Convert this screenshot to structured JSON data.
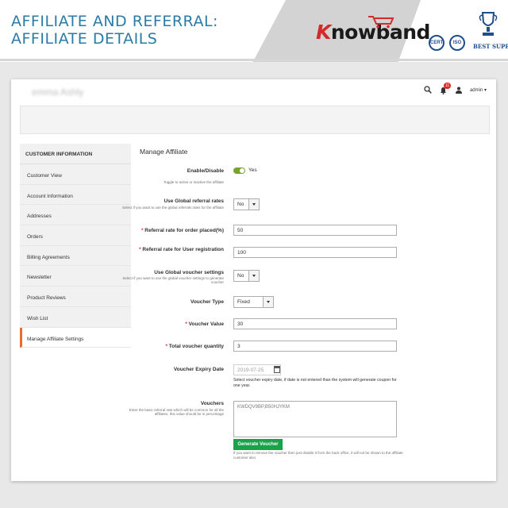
{
  "banner": {
    "title": "AFFILIATE AND REFERRAL: AFFILIATE DETAILS",
    "logo_k": "K",
    "logo_rest": "nowband",
    "badge_iso": "ISO",
    "badge_seal": "CERT",
    "best_support": "BEST SUPPORT"
  },
  "header": {
    "customer_name": "emma Ashly",
    "notification_count": "11",
    "user_name": "admin ▾"
  },
  "sidebar": {
    "header": "CUSTOMER INFORMATION",
    "items": [
      {
        "label": "Customer View"
      },
      {
        "label": "Account Information"
      },
      {
        "label": "Addresses"
      },
      {
        "label": "Orders"
      },
      {
        "label": "Billing Agreements"
      },
      {
        "label": "Newsletter"
      },
      {
        "label": "Product Reviews"
      },
      {
        "label": "Wish List"
      },
      {
        "label": "Manage Affiliate Settings"
      }
    ]
  },
  "form": {
    "title": "Manage Affiliate",
    "enable": {
      "label": "Enable/Disable",
      "value": "Yes",
      "note": "Toggle to active or inactive the affiliate"
    },
    "global_referral": {
      "label": "Use Global referral rates",
      "value": "No",
      "note": "Select if you want to use the global referrals rates for the affiliate"
    },
    "referral_order": {
      "label": "Referral rate for order placed(%)",
      "value": "50"
    },
    "referral_user": {
      "label": "Referral rate for User registration",
      "value": "100"
    },
    "global_voucher": {
      "label": "Use Global voucher settings",
      "value": "No",
      "note": "Select if you want to use the global voucher settings to generate voucher"
    },
    "voucher_type": {
      "label": "Voucher Type",
      "value": "Fixed"
    },
    "voucher_value": {
      "label": "Voucher Value",
      "value": "30"
    },
    "voucher_quantity": {
      "label": "Total voucher quantity",
      "value": "3"
    },
    "expiry": {
      "label": "Voucher Expiry Date",
      "placeholder": "2019-07-25",
      "help": "Select voucher expiry date, if date is not entered than the system will generate coupon for one year."
    },
    "vouchers": {
      "label": "Vouchers",
      "note": "Enter the basic referral rate which will be common for all the affiliates, this value should be in percentage",
      "value": "KWDQV9BP,B50HJYKM"
    },
    "generate_button": "Generate Voucher",
    "generate_help": "If you want to remove the voucher then just disable it from the back office, it will not be shown to the affiliate customer also"
  },
  "colors": {
    "accent_blue": "#2a7ba6",
    "toggle_green": "#79a22e",
    "button_green": "#1aa14b",
    "active_border": "#e86d2f",
    "required": "#e22626"
  }
}
